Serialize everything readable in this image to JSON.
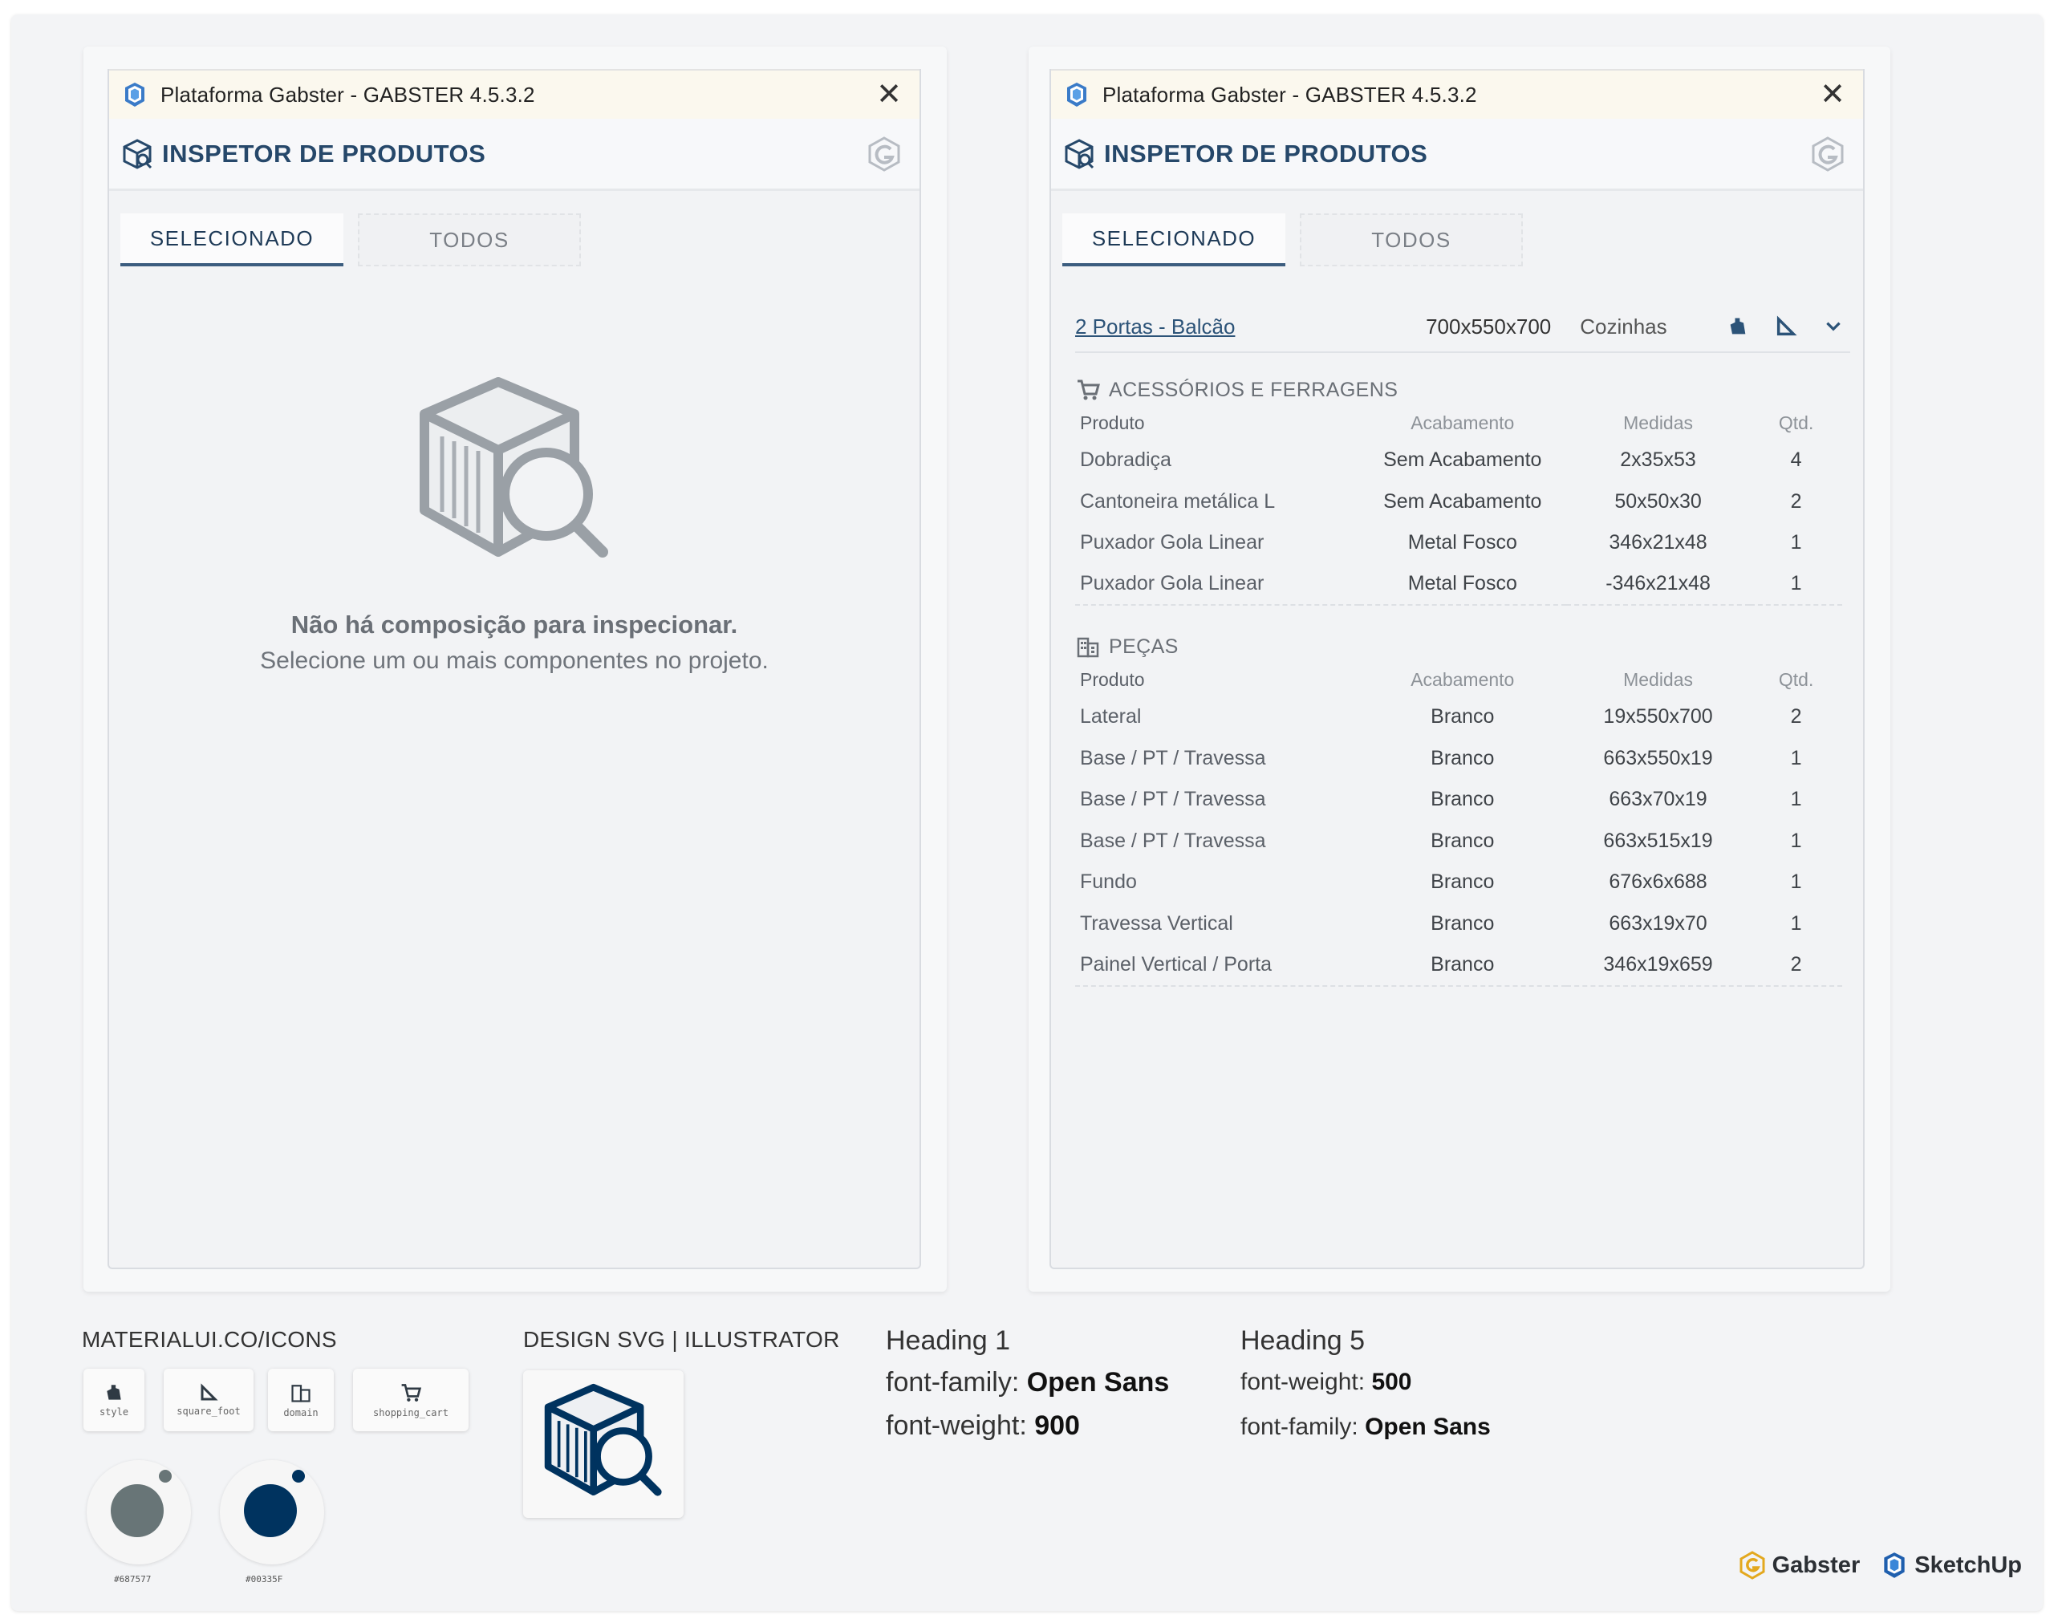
{
  "app": {
    "window_title": "Plataforma Gabster - GABSTER 4.5.3.2",
    "panel_title": "INSPETOR DE PRODUTOS",
    "close_glyph": "✕",
    "tabs": [
      "SELECIONADO",
      "TODOS"
    ]
  },
  "left_window": {
    "empty_title": "Não há composição para inspecionar.",
    "empty_subtitle": "Selecione um ou mais componentes no projeto."
  },
  "right_window": {
    "product": {
      "name": "2 Portas - Balcão",
      "dims": "700x550x700",
      "category": "Cozinhas"
    },
    "accessories": {
      "title": "ACESSÓRIOS E FERRAGENS",
      "columns": [
        "Produto",
        "Acabamento",
        "Medidas",
        "Qtd."
      ],
      "rows": [
        [
          "Dobradiça",
          "Sem Acabamento",
          "2x35x53",
          "4"
        ],
        [
          "Cantoneira metálica L",
          "Sem Acabamento",
          "50x50x30",
          "2"
        ],
        [
          "Puxador Gola Linear",
          "Metal Fosco",
          "346x21x48",
          "1"
        ],
        [
          "Puxador Gola Linear",
          "Metal Fosco",
          "-346x21x48",
          "1"
        ]
      ]
    },
    "parts": {
      "title": "PEÇAS",
      "columns": [
        "Produto",
        "Acabamento",
        "Medidas",
        "Qtd."
      ],
      "rows": [
        [
          "Lateral",
          "Branco",
          "19x550x700",
          "2"
        ],
        [
          "Base / PT / Travessa",
          "Branco",
          "663x550x19",
          "1"
        ],
        [
          "Base / PT / Travessa",
          "Branco",
          "663x70x19",
          "1"
        ],
        [
          "Base / PT / Travessa",
          "Branco",
          "663x515x19",
          "1"
        ],
        [
          "Fundo",
          "Branco",
          "676x6x688",
          "1"
        ],
        [
          "Travessa Vertical",
          "Branco",
          "663x19x70",
          "1"
        ],
        [
          "Painel Vertical / Porta",
          "Branco",
          "346x19x659",
          "2"
        ]
      ]
    }
  },
  "style_guide": {
    "icons_label": "MATERIALUI.CO/ICONS",
    "icon_captions": [
      "style",
      "square_foot",
      "domain",
      "shopping_cart"
    ],
    "design_label": "DESIGN SVG | ILLUSTRATOR",
    "colors": [
      {
        "hex": "#687577",
        "label": "#687577"
      },
      {
        "hex": "#00335F",
        "label": "#00335F"
      }
    ],
    "heading1": {
      "title": "Heading 1",
      "family_label": "font-family:",
      "family_value": "Open Sans",
      "weight_label": "font-weight:",
      "weight_value": "900"
    },
    "heading5": {
      "title": "Heading 5",
      "weight_label": "font-weight:",
      "weight_value": "500",
      "family_label": "font-family:",
      "family_value": "Open Sans"
    },
    "brands": [
      "Gabster",
      "SketchUp"
    ]
  }
}
